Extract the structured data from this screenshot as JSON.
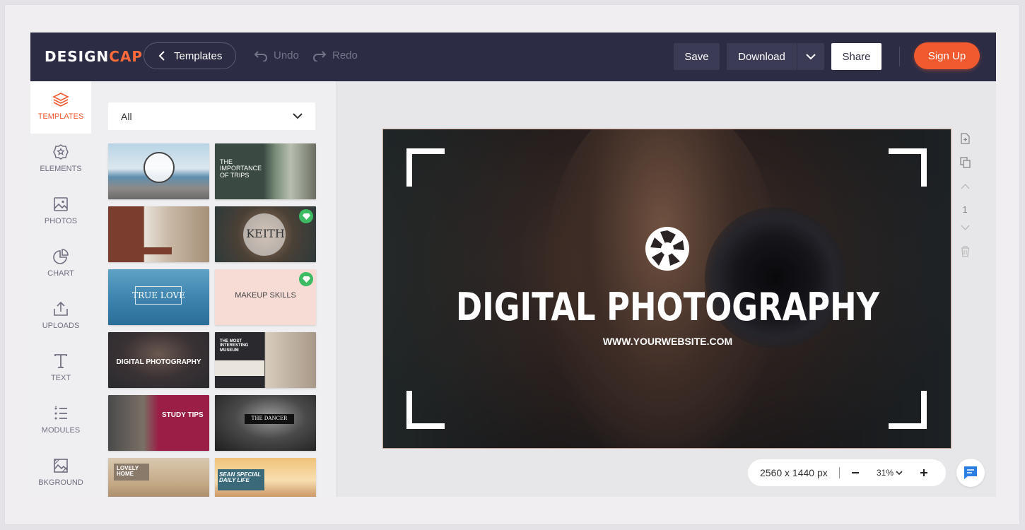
{
  "header": {
    "logo_design": "DESIGN",
    "logo_cap": "CAP",
    "templates_label": "Templates",
    "undo_label": "Undo",
    "redo_label": "Redo",
    "save_label": "Save",
    "download_label": "Download",
    "share_label": "Share",
    "signup_label": "Sign Up"
  },
  "sidebar": {
    "items": [
      {
        "label": "TEMPLATES",
        "icon": "layers-icon",
        "active": true
      },
      {
        "label": "ELEMENTS",
        "icon": "star-badge-icon"
      },
      {
        "label": "PHOTOS",
        "icon": "image-icon"
      },
      {
        "label": "CHART",
        "icon": "pie-chart-icon"
      },
      {
        "label": "UPLOADS",
        "icon": "upload-icon"
      },
      {
        "label": "TEXT",
        "icon": "text-icon"
      },
      {
        "label": "MODULES",
        "icon": "list-icon"
      },
      {
        "label": "BKGROUND",
        "icon": "background-icon"
      }
    ]
  },
  "templates_panel": {
    "filter_value": "All",
    "thumbnails": [
      {
        "text": "",
        "premium": false
      },
      {
        "text": "THE IMPORTANCE OF TRIPS",
        "premium": false
      },
      {
        "text": "",
        "premium": false
      },
      {
        "text": "KEITH",
        "premium": true
      },
      {
        "text": "TRUE LOVE",
        "premium": false
      },
      {
        "text": "MAKEUP SKILLS",
        "premium": true
      },
      {
        "text": "DIGITAL PHOTOGRAPHY",
        "premium": false
      },
      {
        "text": "THE MOST INTERESTING MUSEUM",
        "premium": false
      },
      {
        "text": "STUDY TIPS",
        "premium": false
      },
      {
        "text": "THE DANCER",
        "premium": false
      },
      {
        "text": "LOVELY HOME",
        "premium": false
      },
      {
        "text": "SEAN SPECIAL DAILY LIFE",
        "premium": false
      }
    ]
  },
  "design": {
    "title": "DIGITAL PHOTOGRAPHY",
    "subtitle": "WWW.YOURWEBSITE.COM"
  },
  "page_tools": {
    "page_number": "1"
  },
  "zoom": {
    "size_label": "2560 x 1440 px",
    "zoom_level": "31%"
  },
  "colors": {
    "topbar": "#2c2c45",
    "accent": "#f05a2e",
    "premium": "#3dbb63"
  }
}
